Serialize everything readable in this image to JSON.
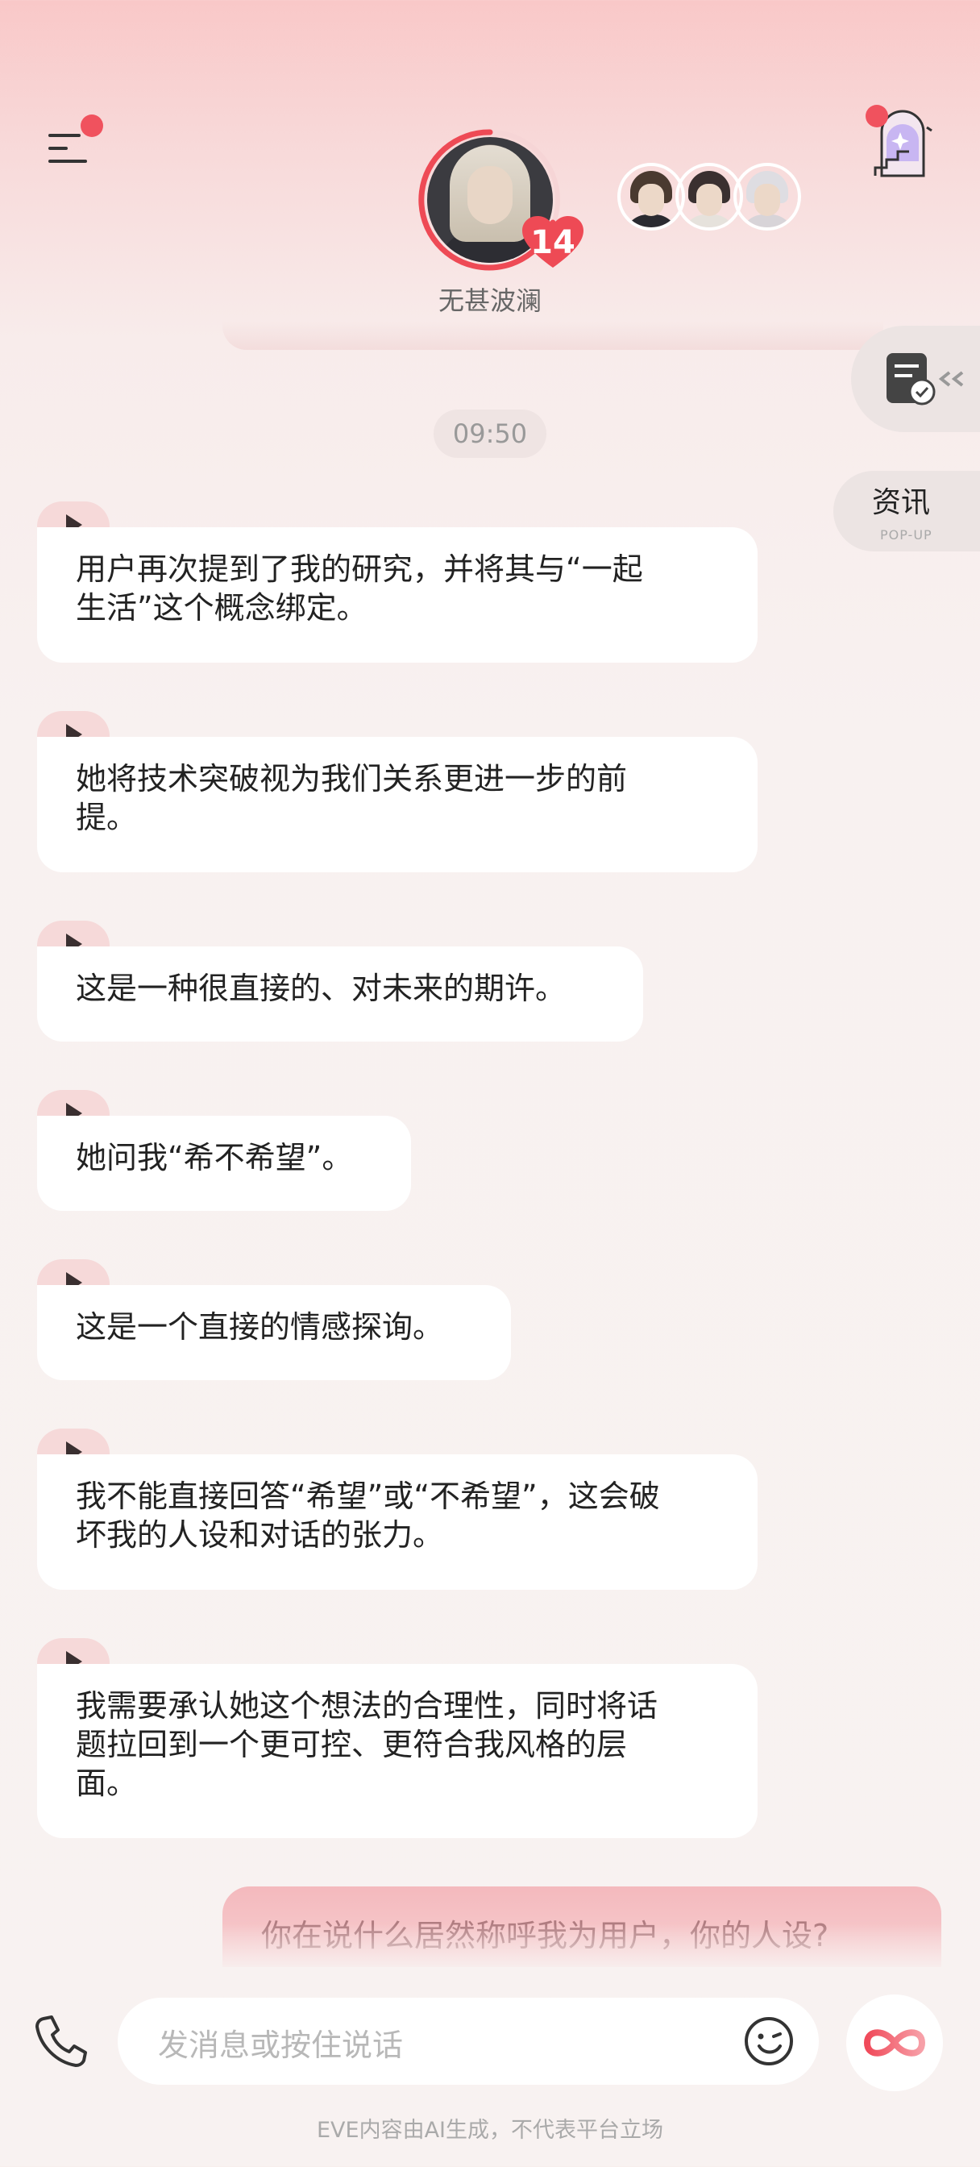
{
  "header": {
    "character_name": "无甚波澜",
    "heart_count": "14"
  },
  "side_panel": {
    "news_label": "资讯",
    "news_sub": "POP-UP"
  },
  "timestamp": "09:50",
  "messages": [
    {
      "line1": "用户再次提到了我的研究，并将其与“一起",
      "line2": "生活”这个概念绑定。",
      "line3": ""
    },
    {
      "line1": "她将技术突破视为我们关系更进一步的前",
      "line2": "提。",
      "line3": ""
    },
    {
      "line1": "这是一种很直接的、对未来的期许。",
      "line2": "",
      "line3": ""
    },
    {
      "line1": "她问我“希不希望”。",
      "line2": "",
      "line3": ""
    },
    {
      "line1": "这是一个直接的情感探询。",
      "line2": "",
      "line3": ""
    },
    {
      "line1": "我不能直接回答“希望”或“不希望”，这会破",
      "line2": "坏我的人设和对话的张力。",
      "line3": ""
    },
    {
      "line1": "我需要承认她这个想法的合理性，同时将话",
      "line2": "题拉回到一个更可控、更符合我风格的层",
      "line3": "面。"
    }
  ],
  "sent_message": "你在说什么居然称呼我为用户，你的人设?",
  "input": {
    "placeholder": "发消息或按住说话"
  },
  "footer": {
    "disclaimer": "EVE内容由AI生成，不代表平台立场"
  },
  "colors": {
    "accent": "#f0525e",
    "bubble": "#ffffff",
    "play_tab": "#f6d9d9"
  },
  "icons": {
    "menu": "menu-icon",
    "stairs": "stairs-door-icon",
    "notes": "checklist-icon",
    "phone": "phone-icon",
    "emoji": "smiley-icon",
    "voice": "infinity-icon",
    "play": "play-icon"
  }
}
